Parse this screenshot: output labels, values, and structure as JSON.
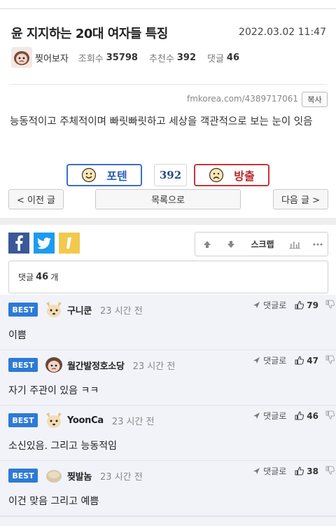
{
  "post": {
    "title": "윤 지지하는 20대 여자들 특징",
    "date": "2022.03.02 11:47",
    "author": "찢어보자",
    "views_label": "조회수",
    "views": "35798",
    "recommends_label": "추천수",
    "recommends": "392",
    "comments_label": "댓글",
    "comments": "46",
    "url": "fmkorea.com/4389717061",
    "copy_label": "복사",
    "body": "능동적이고 주체적이며 빠릿빠릿하고 세상을 객관적으로 보는 눈이 잇음"
  },
  "vote": {
    "up_label": "포텐",
    "count": "392",
    "down_label": "방출"
  },
  "nav": {
    "prev": "< 이전 글",
    "list": "목록으로",
    "next": "다음 글 >"
  },
  "tools": {
    "scrap": "스크랩"
  },
  "comment_summary": {
    "prefix": "댓글",
    "count": "46",
    "suffix": "개"
  },
  "comments": [
    {
      "badge": "BEST",
      "nick": "구니쿤",
      "time": "23 시간 전",
      "reply": "댓글로",
      "likes": "79",
      "text": "이쁨"
    },
    {
      "badge": "BEST",
      "nick": "월간발정호소당",
      "time": "23 시간 전",
      "reply": "댓글로",
      "likes": "47",
      "text": "자기 주관이 있음 ㅋㅋ"
    },
    {
      "badge": "BEST",
      "nick": "YoonCa",
      "time": "23 시간 전",
      "reply": "댓글로",
      "likes": "46",
      "text": "소신있음. 그리고 능동적임"
    },
    {
      "badge": "BEST",
      "nick": "찢발놈",
      "time": "23 시간 전",
      "reply": "댓글로",
      "likes": "38",
      "text": "이건 맞음 그리고 예쁨"
    }
  ],
  "colors": {
    "best_badge": "#2d7ad6",
    "vote_up": "#3a6fc8",
    "vote_down": "#c8343a",
    "comment_bg": "#f1f3f9"
  },
  "icons": {
    "share_facebook": "facebook-icon",
    "share_twitter": "twitter-icon",
    "share_kakao": "kakao-icon",
    "upvote": "arrow-up-icon",
    "downvote": "arrow-down-icon",
    "stats": "bar-chart-icon",
    "more": "more-icon",
    "reply": "reply-arrow-icon",
    "like": "thumbs-up-icon",
    "dislike": "thumbs-down-icon"
  }
}
